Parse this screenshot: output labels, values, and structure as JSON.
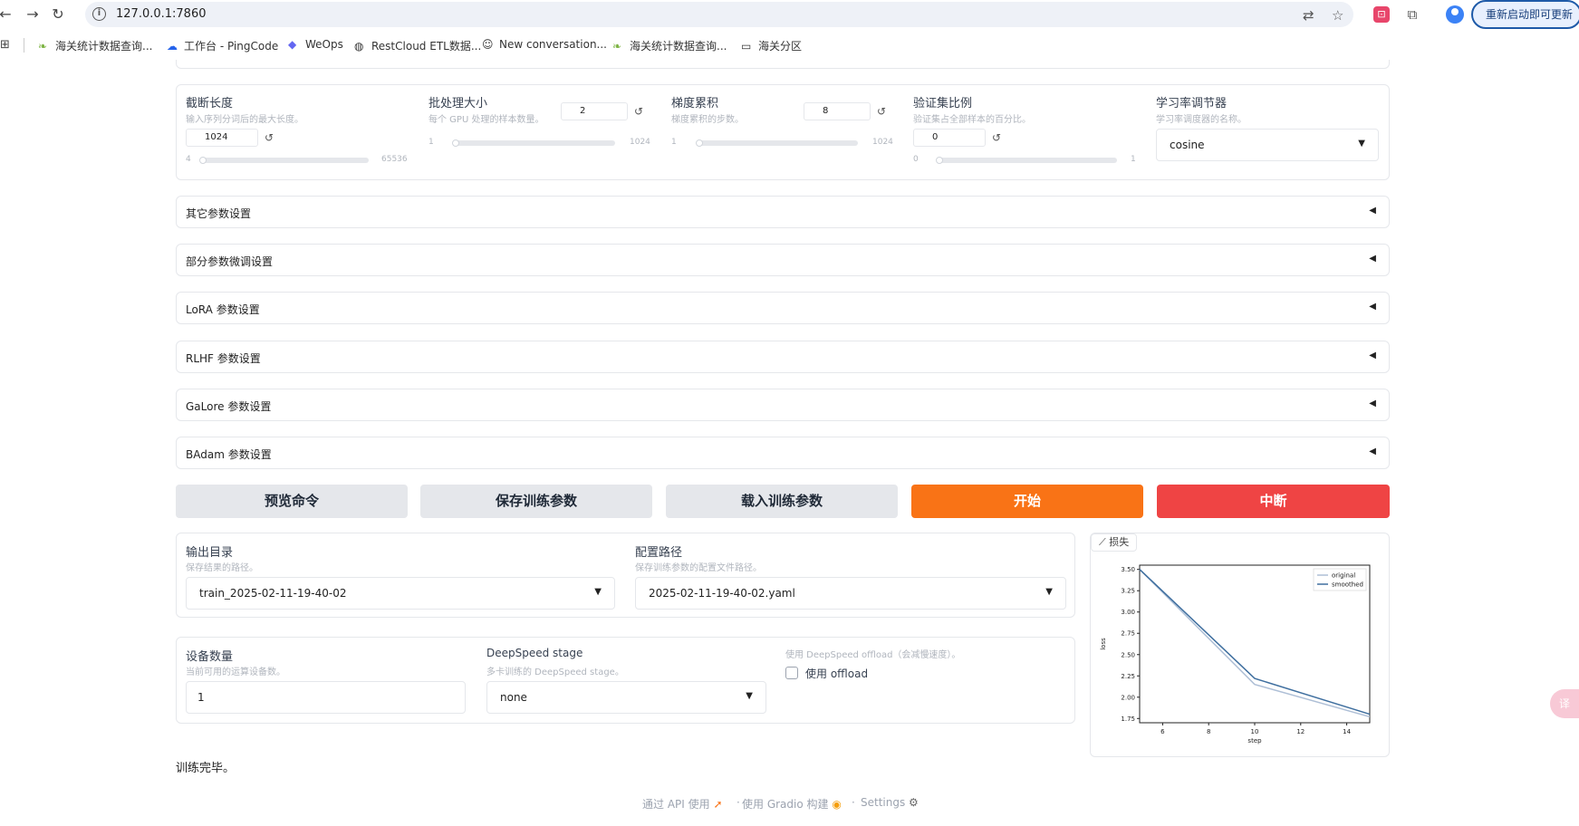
{
  "browser": {
    "url": "127.0.0.1:7860",
    "update_label": "重新启动即可更新",
    "bookmarks": [
      {
        "label": "海关统计数据查询...",
        "icon": "leaf-icon"
      },
      {
        "label": "工作台 - PingCode",
        "icon": "cloud-icon"
      },
      {
        "label": "WeOps",
        "icon": "weops-icon"
      },
      {
        "label": "RestCloud ETL数据...",
        "icon": "globe-icon"
      },
      {
        "label": "New conversation...",
        "icon": "bot-icon"
      },
      {
        "label": "海关统计数据查询...",
        "icon": "leaf-icon"
      },
      {
        "label": "海关分区",
        "icon": "folder-icon"
      }
    ]
  },
  "params": {
    "cutoff": {
      "label": "截断长度",
      "info": "输入序列分词后的最大长度。",
      "value": "1024",
      "min": "4",
      "max": "65536",
      "fraction": 0.015
    },
    "batch": {
      "label": "批处理大小",
      "info": "每个 GPU 处理的样本数量。",
      "value": "2",
      "min": "1",
      "max": "1024",
      "fraction": 0.001
    },
    "grad_acc": {
      "label": "梯度累积",
      "info": "梯度累积的步数。",
      "value": "8",
      "min": "1",
      "max": "1024",
      "fraction": 0.007
    },
    "val_size": {
      "label": "验证集比例",
      "info": "验证集占全部样本的百分比。",
      "value": "0",
      "min": "0",
      "max": "1",
      "fraction": 0
    },
    "lr_scheduler": {
      "label": "学习率调节器",
      "info": "学习率调度器的名称。",
      "value": "cosine"
    }
  },
  "accordions": [
    "其它参数设置",
    "部分参数微调设置",
    "LoRA 参数设置",
    "RLHF 参数设置",
    "GaLore 参数设置",
    "BAdam 参数设置"
  ],
  "actions": {
    "preview": "预览命令",
    "save": "保存训练参数",
    "load": "载入训练参数",
    "start": "开始",
    "abort": "中断"
  },
  "output": {
    "out_dir_label": "输出目录",
    "out_dir_info": "保存结果的路径。",
    "out_dir_value": "train_2025-02-11-19-40-02",
    "config_label": "配置路径",
    "config_info": "保存训练参数的配置文件路径。",
    "config_value": "2025-02-11-19-40-02.yaml"
  },
  "device": {
    "count_label": "设备数量",
    "count_info": "当前可用的运算设备数。",
    "count_value": "1",
    "ds_label": "DeepSpeed stage",
    "ds_info": "多卡训练的 DeepSpeed stage。",
    "ds_value": "none",
    "offload_info": "使用 DeepSpeed offload（会减慢速度）。",
    "offload_label": "使用 offload"
  },
  "plot": {
    "tag": "损失"
  },
  "chart_data": {
    "type": "line",
    "title": "",
    "xlabel": "step",
    "ylabel": "loss",
    "xlim": [
      5,
      15
    ],
    "ylim": [
      1.7,
      3.55
    ],
    "xticks": [
      6,
      8,
      10,
      12,
      14
    ],
    "yticks": [
      1.75,
      2.0,
      2.25,
      2.5,
      2.75,
      3.0,
      3.25,
      3.5
    ],
    "legend_position": "top-right",
    "series": [
      {
        "name": "original",
        "color": "#aebfd6",
        "x": [
          5,
          10,
          15
        ],
        "y": [
          3.5,
          2.15,
          1.77
        ]
      },
      {
        "name": "smoothed",
        "color": "#3f6f9f",
        "x": [
          5,
          10,
          15
        ],
        "y": [
          3.5,
          2.22,
          1.8
        ]
      }
    ]
  },
  "status_text": "训练完毕。",
  "footer": {
    "api": "通过 API 使用",
    "gradio": "使用 Gradio 构建",
    "settings": "Settings"
  }
}
